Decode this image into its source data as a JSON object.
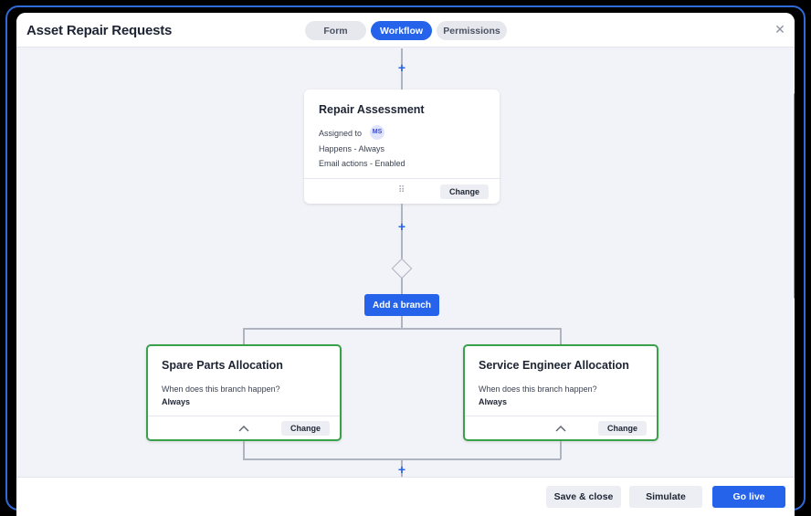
{
  "header": {
    "title": "Asset Repair Requests",
    "tabs": [
      {
        "label": "Form",
        "active": false
      },
      {
        "label": "Workflow",
        "active": true
      },
      {
        "label": "Permissions",
        "active": false
      }
    ],
    "close_icon": "close-icon"
  },
  "workflow": {
    "plus_symbol": "+",
    "step": {
      "title": "Repair Assessment",
      "assigned_label": "Assigned to",
      "assignee_initials": "MS",
      "happens": "Happens - Always",
      "email_actions": "Email actions - Enabled",
      "change_label": "Change",
      "drag_glyph": "⠿"
    },
    "add_branch_label": "Add a branch",
    "branches": [
      {
        "title": "Spare Parts Allocation",
        "question": "When does this branch happen?",
        "answer": "Always",
        "change_label": "Change"
      },
      {
        "title": "Service Engineer Allocation",
        "question": "When does this branch happen?",
        "answer": "Always",
        "change_label": "Change"
      }
    ]
  },
  "footer": {
    "save_close_label": "Save & close",
    "simulate_label": "Simulate",
    "go_live_label": "Go live"
  },
  "colors": {
    "accent": "#2563eb",
    "branch_border": "#3aa14a",
    "connector": "#aeb4c0",
    "canvas_bg": "#f1f3f8"
  }
}
